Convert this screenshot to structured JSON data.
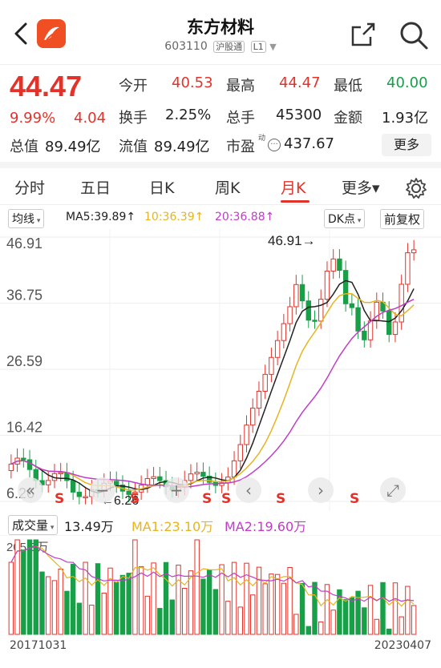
{
  "header": {
    "title": "东方材料",
    "code": "603110",
    "market_tag": "沪股通",
    "level_tag": "L1"
  },
  "quote": {
    "price": "44.47",
    "change_pct": "9.99%",
    "change": "4.04",
    "open_label": "今开",
    "open": "40.53",
    "high_label": "最高",
    "high": "44.47",
    "low_label": "最低",
    "low": "40.00",
    "turnover_label": "换手",
    "turnover": "2.25%",
    "volume_label": "总手",
    "volume": "45300",
    "amount_label": "金额",
    "amount": "1.93亿",
    "mktcap_label": "总值",
    "mktcap": "89.49亿",
    "float_label": "流值",
    "float_cap": "89.49亿",
    "pe_label": "市盈",
    "pe_sup": "动",
    "pe": "437.67",
    "more_label": "更多"
  },
  "tabs": [
    {
      "label": "分时"
    },
    {
      "label": "五日"
    },
    {
      "label": "日K"
    },
    {
      "label": "周K"
    },
    {
      "label": "月K"
    },
    {
      "label": "更多▾"
    }
  ],
  "ma_bar": {
    "type": "均线",
    "ma5": "MA5:39.89↑",
    "ma10": "10:36.39↑",
    "ma20": "20:36.88↑",
    "dk": "DK点",
    "adjust": "前复权",
    "colors": {
      "ma5": "#222222",
      "ma10": "#e6b422",
      "ma20": "#c03cc8"
    }
  },
  "chart_axis": {
    "ticks": [
      "46.91",
      "36.75",
      "26.59",
      "16.42",
      "6.26"
    ],
    "max_label": "46.91",
    "min_label": "6.26",
    "s_marker": "S"
  },
  "vol_bar": {
    "type": "成交量",
    "value": "13.49万",
    "ma1": "MA1:23.10万",
    "ma2": "MA2:19.60万",
    "axis_max": "205.5万",
    "colors": {
      "ma1": "#e6b422",
      "ma2": "#c03cc8"
    }
  },
  "dates": {
    "start": "20171031",
    "end": "20230407"
  },
  "colors": {
    "up": "#e2332b",
    "down": "#18a048",
    "brand": "#f04e23"
  }
}
